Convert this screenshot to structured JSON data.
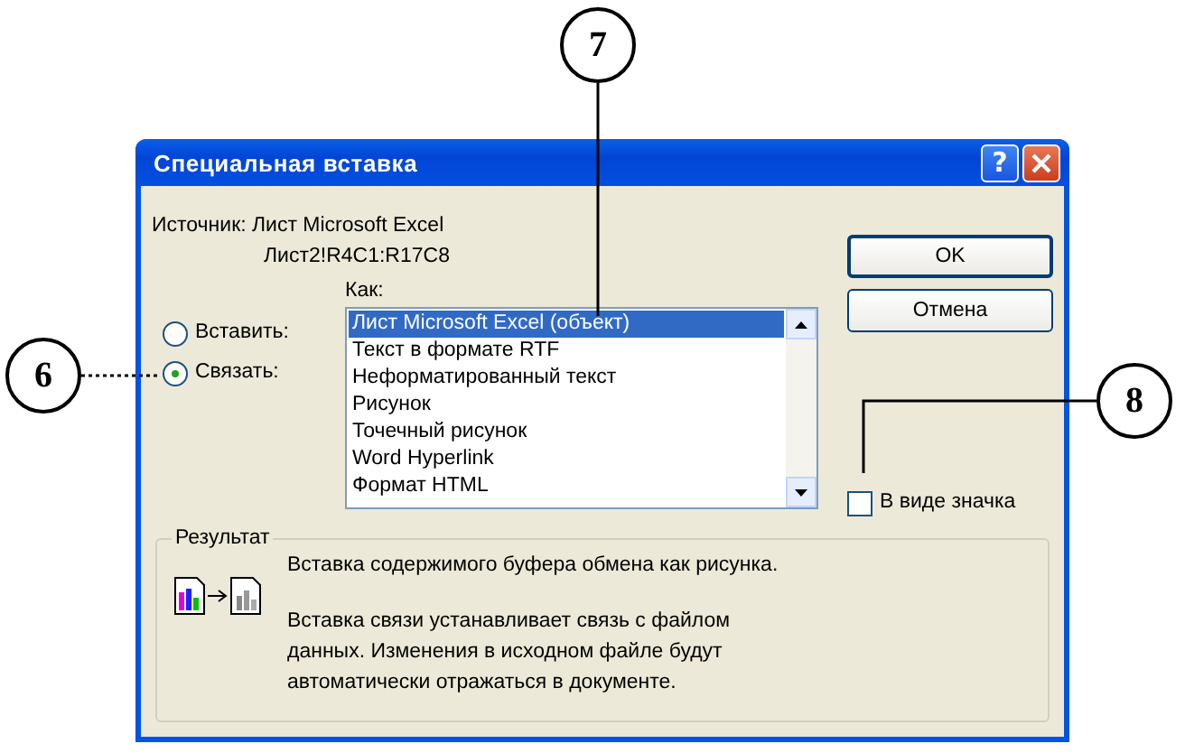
{
  "dialog": {
    "title": "Специальная вставка",
    "help_button": "?"
  },
  "source": {
    "label": "Источник: Лист Microsoft Excel",
    "range": "Лист2!R4C1:R17C8"
  },
  "as_label": "Как:",
  "options": [
    {
      "label": "Вставить:",
      "selected": false
    },
    {
      "label": "Связать:",
      "selected": true
    }
  ],
  "formats": [
    {
      "label": "Лист Microsoft Excel (объект)",
      "selected": true
    },
    {
      "label": "Текст в формате RTF",
      "selected": false
    },
    {
      "label": "Неформатированный текст",
      "selected": false
    },
    {
      "label": "Рисунок",
      "selected": false
    },
    {
      "label": "Точечный рисунок",
      "selected": false
    },
    {
      "label": "Word Hyperlink",
      "selected": false
    },
    {
      "label": "Формат HTML",
      "selected": false
    }
  ],
  "buttons": [
    {
      "label": "OK",
      "default": true
    },
    {
      "label": "Отмена",
      "default": false
    }
  ],
  "icon_checkbox": {
    "label": "В виде значка",
    "checked": false
  },
  "result": {
    "title": "Результат",
    "paragraphs": [
      "Вставка содержимого буфера обмена как рисунка.",
      "Вставка связи устанавливает связь с файлом данных. Изменения в исходном файле будут автоматически отражаться в документе."
    ]
  },
  "callouts": [
    {
      "number": "6"
    },
    {
      "number": "7"
    },
    {
      "number": "8"
    }
  ]
}
